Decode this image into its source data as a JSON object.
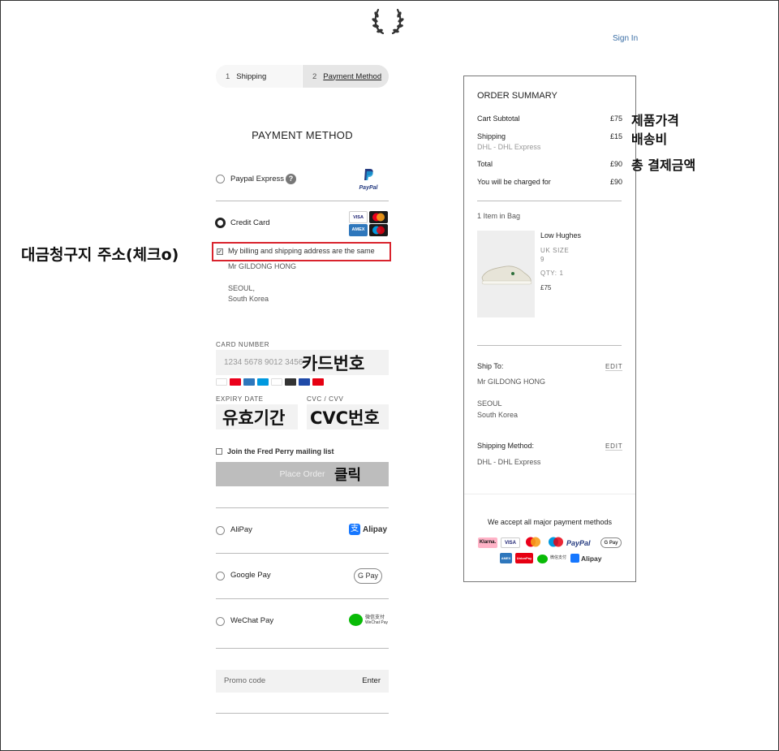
{
  "header": {
    "sign_in": "Sign In",
    "logo_icon": "laurel-wreath-icon"
  },
  "steps": [
    {
      "num": "1",
      "label": "Shipping"
    },
    {
      "num": "2",
      "label": "Payment Method"
    }
  ],
  "payment": {
    "title": "PAYMENT METHOD",
    "paypal_label": "Paypal Express",
    "paypal_logo": "PayPal",
    "help_glyph": "?",
    "credit_label": "Credit Card",
    "billing_same_label": "My billing and shipping address are the same",
    "billing_name": "Mr GILDONG HONG",
    "billing_city": "SEOUL,",
    "billing_country": "South Korea",
    "card_number_label": "CARD NUMBER",
    "card_number_placeholder": "1234 5678 9012 3456",
    "expiry_label": "EXPIRY DATE",
    "cvc_label": "CVC / CVV",
    "mailing_label": "Join the Fred Perry mailing list",
    "place_order": "Place Order",
    "alipay_label": "AliPay",
    "alipay_logo": "Alipay",
    "googlepay_label": "Google Pay",
    "googlepay_logo": "G Pay",
    "wechat_label": "WeChat Pay",
    "wechat_logo_cn": "微信支付",
    "wechat_logo_en": "WeChat Pay",
    "promo_label": "Promo code",
    "promo_enter": "Enter"
  },
  "card_logos": [
    "VISA",
    "MC",
    "AMEX",
    "Maestro"
  ],
  "annotations": {
    "billing_check": "대금청구지 주소(체크o)",
    "card_number": "카드번호",
    "expiry": "유효기간",
    "cvc": "CVC번호",
    "click": "클릭",
    "product_price": "제품가격",
    "shipping_fee": "배송비",
    "total": "총 결제금액"
  },
  "summary": {
    "title": "ORDER SUMMARY",
    "subtotal_label": "Cart Subtotal",
    "subtotal_value": "£75",
    "shipping_label": "Shipping",
    "shipping_value": "£15",
    "shipping_method_sub": "DHL - DHL Express",
    "total_label": "Total",
    "total_value": "£90",
    "charged_label": "You will be charged for",
    "charged_value": "£90",
    "items_count": "1 Item in Bag",
    "item": {
      "name": "Low Hughes",
      "size_label": "UK SIZE",
      "size_value": "9",
      "qty": "QTY: 1",
      "price": "£75"
    },
    "ship_to_label": "Ship To:",
    "edit": "EDIT",
    "ship_name": "Mr GILDONG HONG",
    "ship_city": "SEOUL",
    "ship_country": "South Korea",
    "ship_method_label": "Shipping Method:",
    "ship_method_value": "DHL - DHL Express",
    "accept_text": "We accept all major payment methods",
    "badges_row1": [
      "Klarna.",
      "VISA",
      "",
      "",
      "PayPal",
      "G Pay"
    ],
    "badges_row2": [
      "AMEX",
      "UnionPay",
      "微信支付",
      "Alipay"
    ]
  },
  "colors": {
    "accent_link": "#3a6ea5",
    "annotation_red": "#d9232d",
    "place_order_bg": "#bdbdbd"
  }
}
